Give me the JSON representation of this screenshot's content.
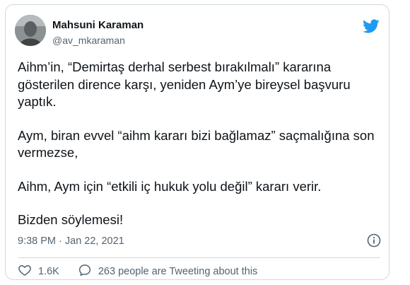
{
  "tweet": {
    "author_name": "Mahsuni Karaman",
    "handle": "@av_mkaraman",
    "paragraphs": [
      "Aihm’in, “Demirtaş derhal serbest bırakılmalı” kararına\ngösterilen dirence karşı, yeniden Aym’ye bireysel başvuru\nyaptık.",
      "Aym, biran evvel “aihm kararı bizi bağlamaz” saçmalığına son\nvermezse,",
      "Aihm, Aym için “etkili iç hukuk yolu değil” kararı verir.",
      "Bizden söylemesi!"
    ],
    "timestamp": "9:38 PM · Jan 22, 2021",
    "like_count": "1.6K",
    "people_tweeting": "263 people are Tweeting about this"
  },
  "icons": {
    "brand": "twitter-bird-icon",
    "info": "info-icon",
    "like": "heart-icon",
    "reply": "speech-bubble-icon"
  },
  "colors": {
    "twitter_blue": "#1d9bf0",
    "text": "#0f1419",
    "secondary": "#536471",
    "border": "#cfd9de"
  }
}
